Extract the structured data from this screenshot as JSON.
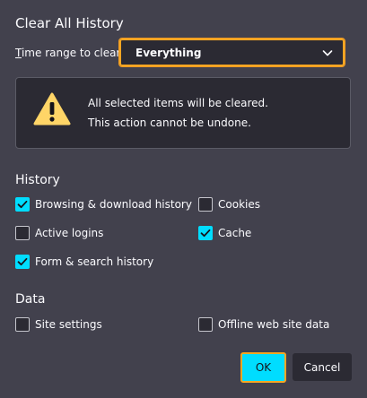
{
  "dialog": {
    "title": "Clear All History"
  },
  "time_range": {
    "label": "Time range to clear:",
    "selected": "Everything"
  },
  "warning": {
    "line1": "All selected items will be cleared.",
    "line2": "This action cannot be undone."
  },
  "history": {
    "heading": "History",
    "items": [
      {
        "label": "Browsing & download history",
        "checked": true
      },
      {
        "label": "Cookies",
        "checked": false
      },
      {
        "label": "Active logins",
        "checked": false
      },
      {
        "label": "Cache",
        "checked": true
      },
      {
        "label": "Form & search history",
        "checked": true
      }
    ]
  },
  "data_section": {
    "heading": "Data",
    "items": [
      {
        "label": "Site settings",
        "checked": false
      },
      {
        "label": "Offline web site data",
        "checked": false
      }
    ]
  },
  "buttons": {
    "ok": "OK",
    "cancel": "Cancel"
  },
  "colors": {
    "background": "#42414d",
    "field": "#2b2a33",
    "accent": "#00ddff",
    "focus_ring": "#f5a623",
    "warning_icon": "#ffd567"
  },
  "icons": {
    "select_chevron": "chevron-down-icon",
    "warning": "warning-icon",
    "checkmark": "checkmark-icon"
  }
}
